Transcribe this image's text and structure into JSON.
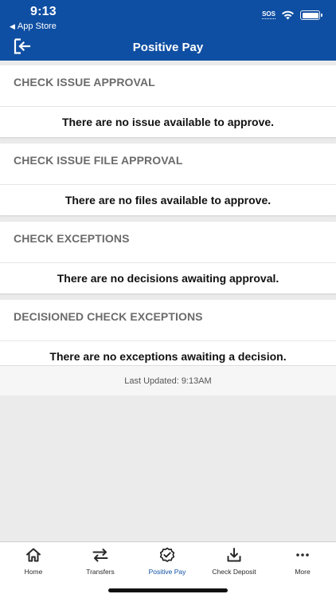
{
  "status": {
    "time": "9:13",
    "back_label": "App Store",
    "sos": "SOS"
  },
  "header": {
    "title": "Positive Pay"
  },
  "sections": [
    {
      "title": "CHECK ISSUE APPROVAL",
      "message": "There are no issue available to approve."
    },
    {
      "title": "CHECK ISSUE FILE APPROVAL",
      "message": "There are no files available to approve."
    },
    {
      "title": "CHECK EXCEPTIONS",
      "message": "There are no decisions awaiting approval."
    },
    {
      "title": "DECISIONED CHECK EXCEPTIONS",
      "message": "There are no exceptions awaiting a decision."
    }
  ],
  "last_updated": "Last Updated: 9:13AM",
  "tabs": [
    {
      "label": "Home",
      "icon": "home-icon"
    },
    {
      "label": "Transfers",
      "icon": "transfer-arrows-icon"
    },
    {
      "label": "Positive Pay",
      "icon": "verified-badge-icon",
      "active": true
    },
    {
      "label": "Check Deposit",
      "icon": "download-icon"
    },
    {
      "label": "More",
      "icon": "more-dots-icon"
    }
  ],
  "colors": {
    "brand_blue": "#0f4fa3",
    "background": "#ebebeb",
    "section_title": "#6b6b6b"
  }
}
